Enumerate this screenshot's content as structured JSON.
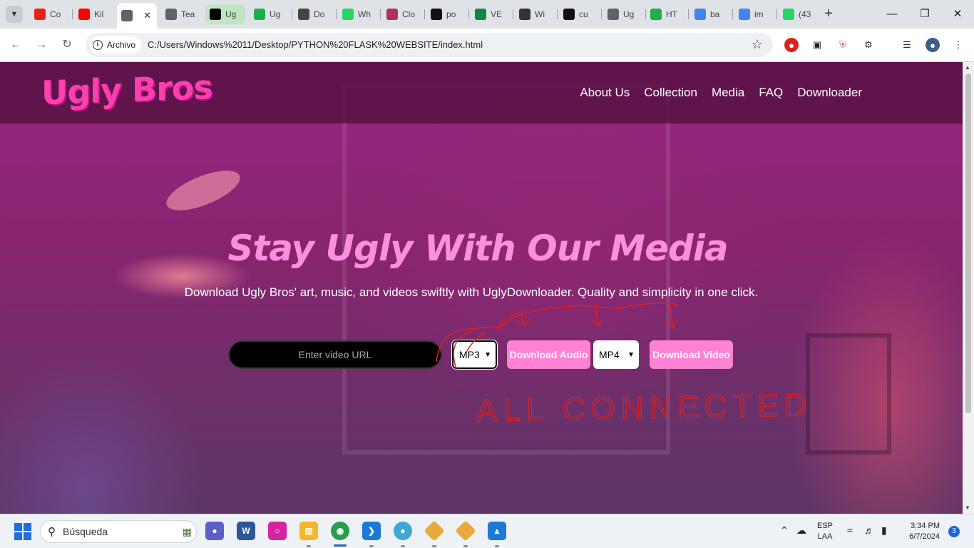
{
  "browser": {
    "tabs": [
      {
        "title": "Co",
        "icon": "youtube-studio-icon",
        "color": "#e62117"
      },
      {
        "title": "Kil",
        "icon": "youtube-icon",
        "color": "#ff0000"
      },
      {
        "title": "",
        "icon": "globe-icon",
        "color": "#5f6368",
        "active": true
      },
      {
        "title": "Tea",
        "icon": "globe-icon",
        "color": "#5f6368"
      },
      {
        "title": "Ug",
        "icon": "x-icon",
        "color": "#000000",
        "highlight": true
      },
      {
        "title": "Ug",
        "icon": "sparkle-icon",
        "color": "#1fae4b"
      },
      {
        "title": "Do",
        "icon": "openai-icon",
        "color": "#444444"
      },
      {
        "title": "Wh",
        "icon": "whatsapp-icon",
        "color": "#25d366"
      },
      {
        "title": "Clo",
        "icon": "cloud-icon",
        "color": "#b03060"
      },
      {
        "title": "po",
        "icon": "m-icon",
        "color": "#111111"
      },
      {
        "title": "VE",
        "icon": "v-icon",
        "color": "#0f8a3c"
      },
      {
        "title": "Wi",
        "icon": "film-icon",
        "color": "#333333"
      },
      {
        "title": "cu",
        "icon": "m-icon",
        "color": "#111111"
      },
      {
        "title": "Ug",
        "icon": "globe-icon",
        "color": "#5f6368"
      },
      {
        "title": "HT",
        "icon": "w-icon",
        "color": "#1fae4b"
      },
      {
        "title": "ba",
        "icon": "google-icon",
        "color": "#4285f4"
      },
      {
        "title": "im",
        "icon": "google-icon",
        "color": "#4285f4"
      },
      {
        "title": "(43",
        "icon": "whatsapp-icon",
        "color": "#25d366"
      }
    ],
    "site_chip": "Archivo",
    "url": "C:/Users/Windows%2011/Desktop/PYTHON%20FLASK%20WEBSITE/index.html"
  },
  "site": {
    "logo": "Ugly Bros",
    "nav": [
      "About Us",
      "Collection",
      "Media",
      "FAQ",
      "Downloader"
    ],
    "hero_title": "Stay Ugly With Our Media",
    "hero_subtitle": "Download Ugly Bros' art, music, and videos swiftly with UglyDownloader. Quality and simplicity in one click.",
    "url_placeholder": "Enter video URL",
    "audio_format": "MP3",
    "download_audio": "Download Audio",
    "video_format": "MP4",
    "download_video": "Download Video",
    "annotation_text": "ALL CONNECTED"
  },
  "taskbar": {
    "search_placeholder": "Búsqueda",
    "apps": [
      "teams-icon",
      "word-icon",
      "instagram-icon",
      "file-explorer-icon",
      "chrome-icon",
      "vscode-icon",
      "paint-icon",
      "git-icon",
      "git-icon",
      "photos-icon"
    ],
    "lang_line1": "ESP",
    "lang_line2": "LAA",
    "time": "3:34 PM",
    "date": "6/7/2024",
    "notifications": "3"
  },
  "colors": {
    "brand_pink": "#ff3fb0",
    "button_pink": "#ff82d4",
    "hero_title": "#ff8ee0",
    "annotation_red": "#e0201e"
  }
}
